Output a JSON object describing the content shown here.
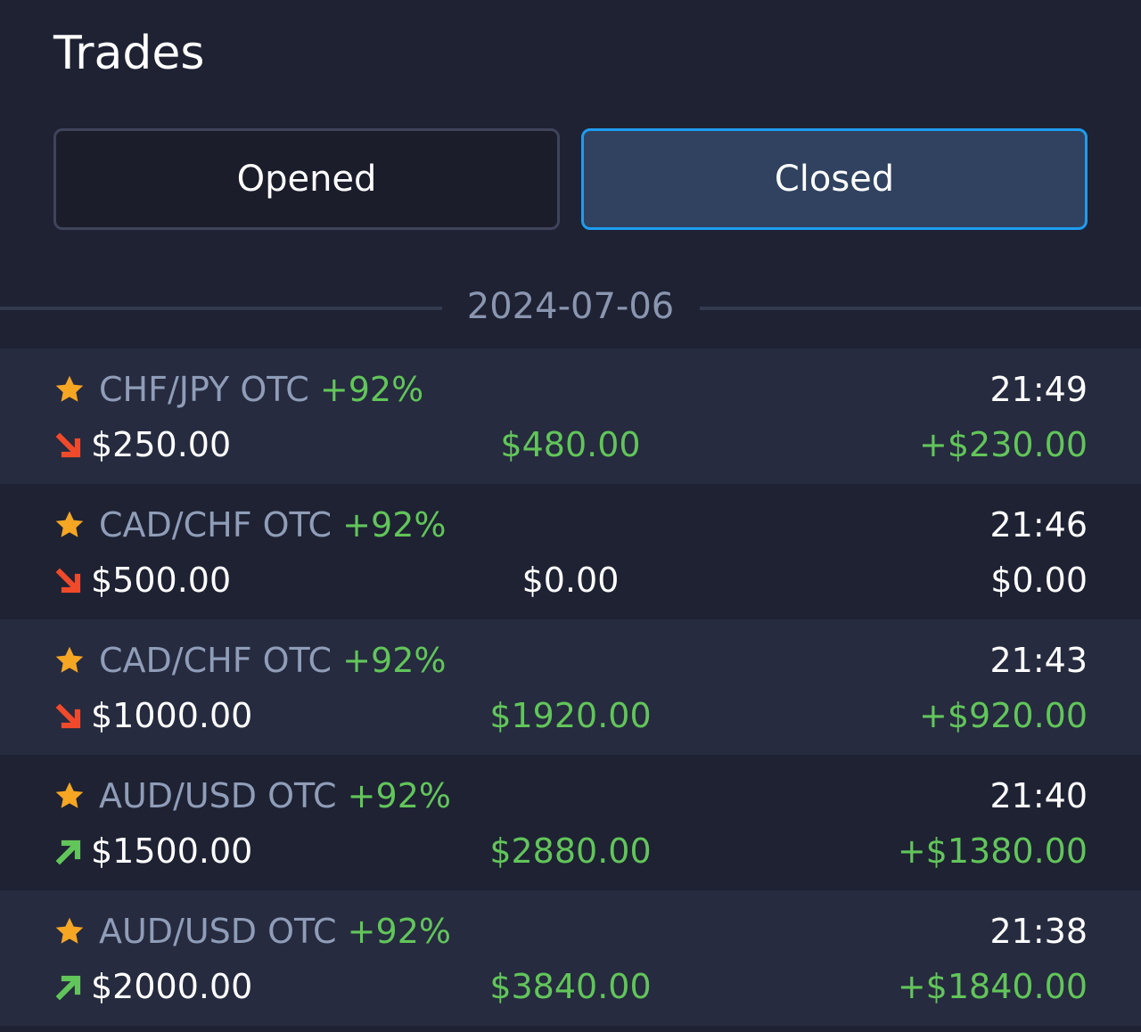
{
  "header": {
    "title": "Trades"
  },
  "tabs": {
    "opened": "Opened",
    "closed": "Closed",
    "active": "closed"
  },
  "date_group": "2024-07-06",
  "colors": {
    "background": "#1e2233",
    "row_alt": "#262b3f",
    "accent_blue": "#1e9cf0",
    "green": "#62c55a",
    "red": "#f04a2a",
    "star": "#f5a623",
    "muted": "#8f9db8"
  },
  "trades": [
    {
      "asset": "CHF/JPY OTC",
      "payout_pct": "+92%",
      "time": "21:49",
      "direction": "down",
      "amount": "$250.00",
      "payout": "$480.00",
      "profit": "+$230.00",
      "result": "win",
      "star_icon": "star-icon",
      "direction_icon": "arrow-down-right-icon"
    },
    {
      "asset": "CAD/CHF OTC",
      "payout_pct": "+92%",
      "time": "21:46",
      "direction": "down",
      "amount": "$500.00",
      "payout": "$0.00",
      "profit": "$0.00",
      "result": "loss",
      "star_icon": "star-icon",
      "direction_icon": "arrow-down-right-icon"
    },
    {
      "asset": "CAD/CHF OTC",
      "payout_pct": "+92%",
      "time": "21:43",
      "direction": "down",
      "amount": "$1000.00",
      "payout": "$1920.00",
      "profit": "+$920.00",
      "result": "win",
      "star_icon": "star-icon",
      "direction_icon": "arrow-down-right-icon"
    },
    {
      "asset": "AUD/USD OTC",
      "payout_pct": "+92%",
      "time": "21:40",
      "direction": "up",
      "amount": "$1500.00",
      "payout": "$2880.00",
      "profit": "+$1380.00",
      "result": "win",
      "star_icon": "star-icon",
      "direction_icon": "arrow-up-right-icon"
    },
    {
      "asset": "AUD/USD OTC",
      "payout_pct": "+92%",
      "time": "21:38",
      "direction": "up",
      "amount": "$2000.00",
      "payout": "$3840.00",
      "profit": "+$1840.00",
      "result": "win",
      "star_icon": "star-icon",
      "direction_icon": "arrow-up-right-icon"
    }
  ]
}
